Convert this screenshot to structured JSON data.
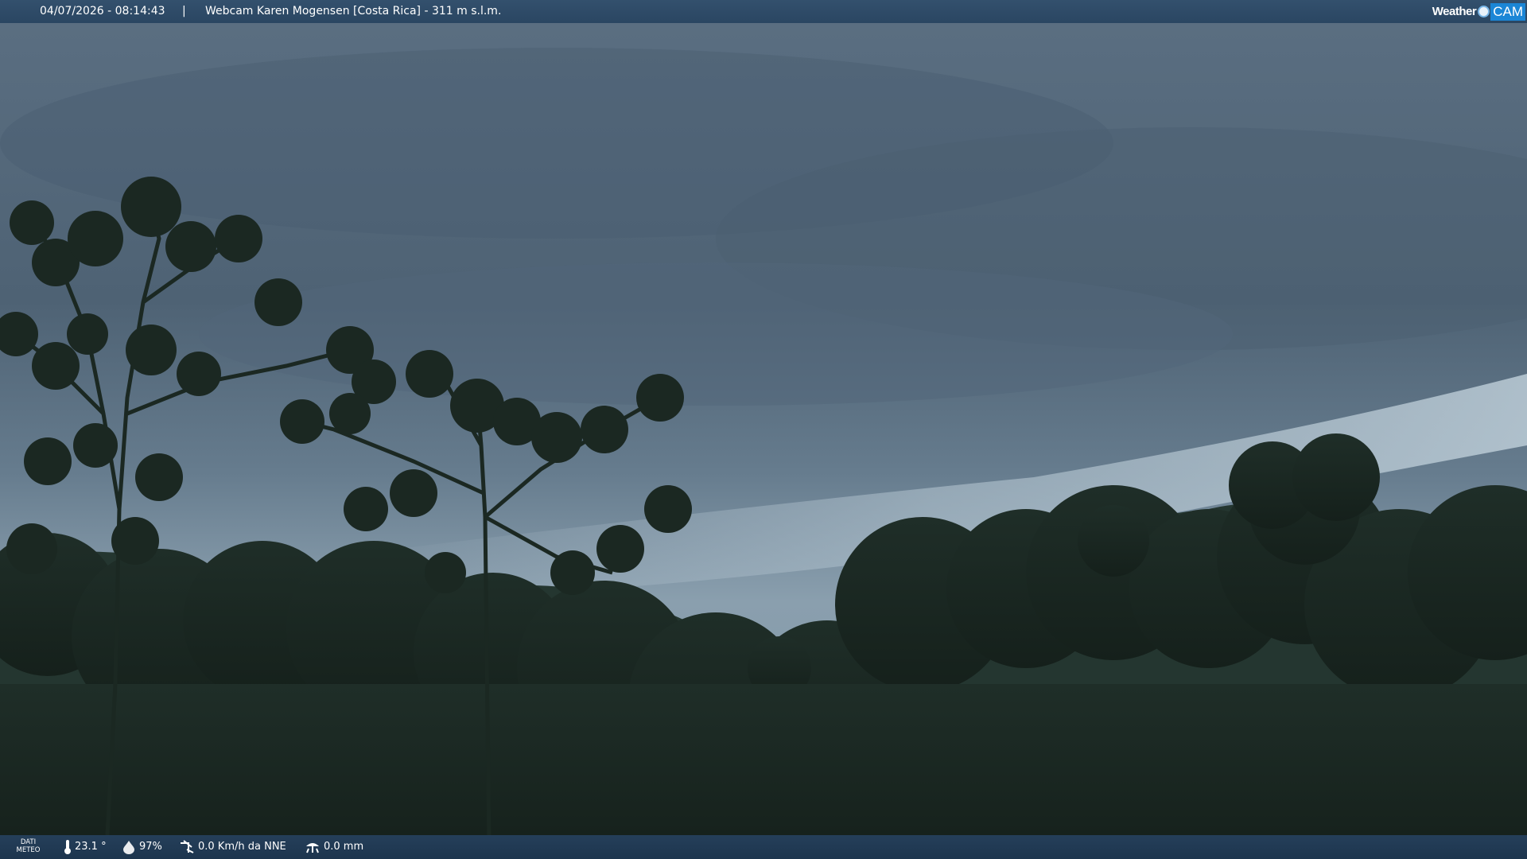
{
  "header": {
    "timestamp": "04/07/2026 - 08:14:43",
    "separator": "|",
    "title": "Webcam Karen Mogensen [Costa Rica]  - 311 m s.l.m."
  },
  "logo": {
    "word1": "Weather",
    "word2": "CAM"
  },
  "meteo": {
    "label_line1": "DATI",
    "label_line2": "METEO",
    "temperature": "23.1 °",
    "humidity": "97%",
    "wind": "0.0 Km/h da NNE",
    "rain": "0.0 mm"
  },
  "icons": [
    "thermometer-icon",
    "humidity-drop-icon",
    "wind-icon",
    "rain-gauge-icon"
  ],
  "colors": {
    "header_bg": "#2c4864",
    "footer_bg": "#213a54",
    "logo_accent": "#1b86d6"
  }
}
